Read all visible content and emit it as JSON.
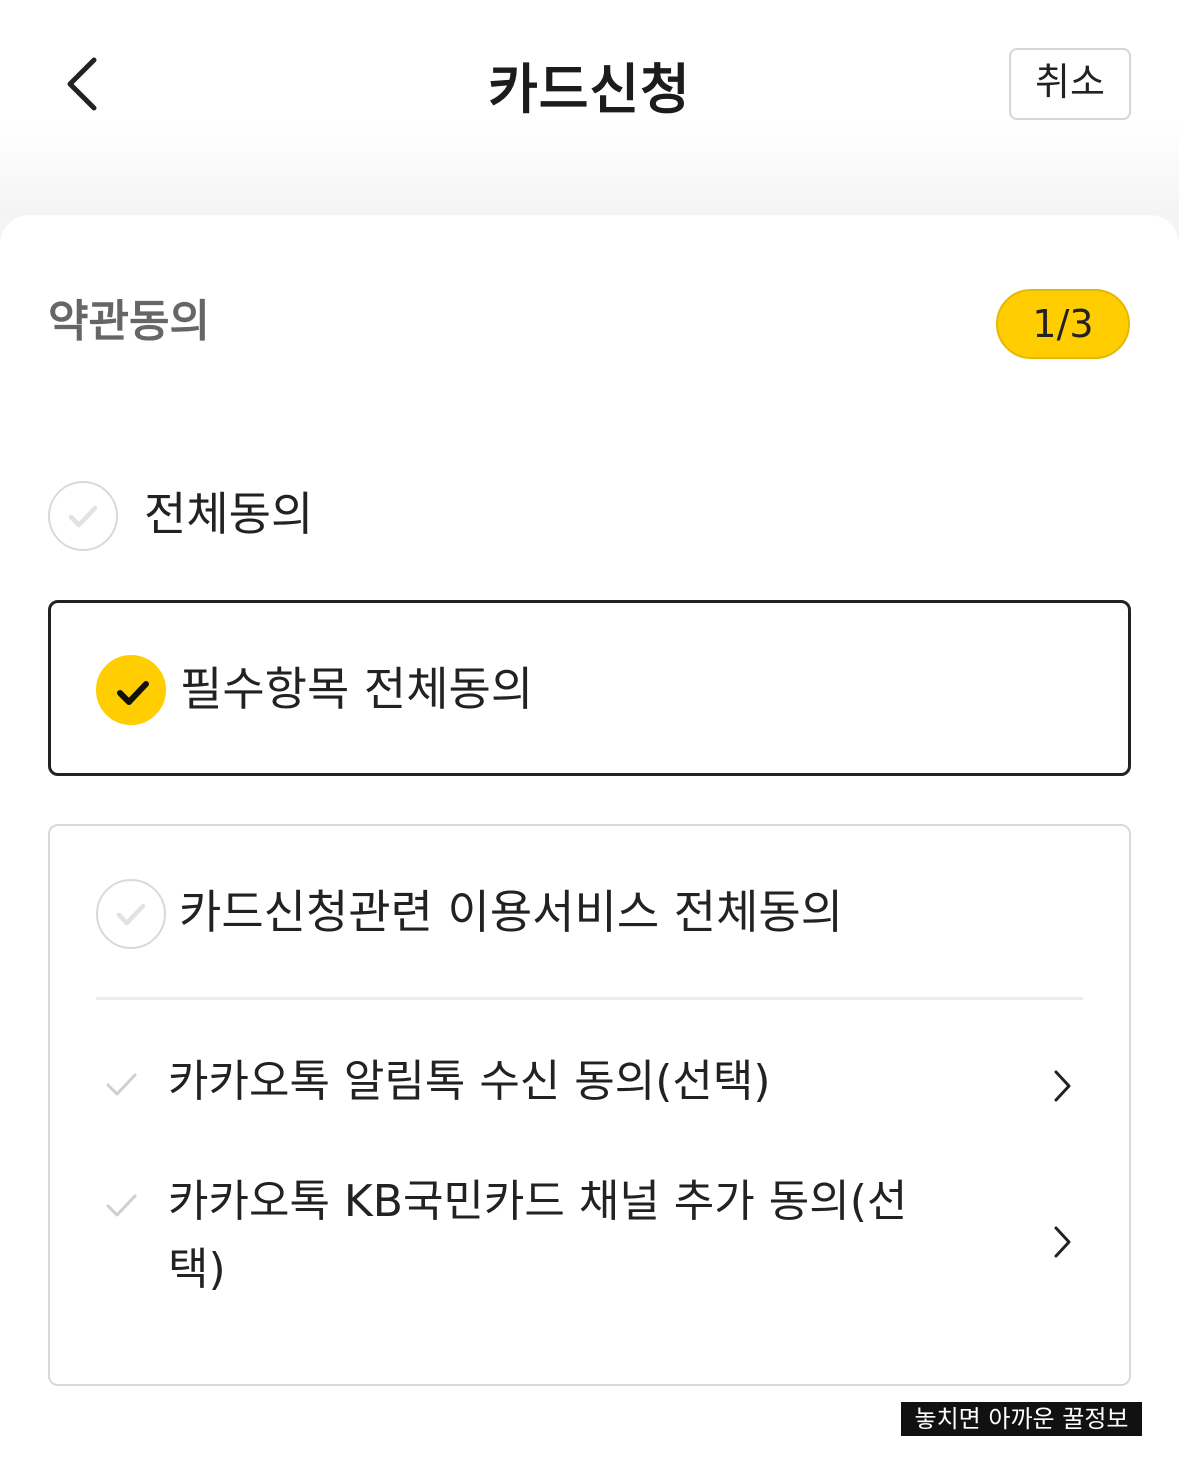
{
  "header": {
    "title": "카드신청",
    "cancel_label": "취소"
  },
  "section": {
    "title": "약관동의",
    "step": "1/3"
  },
  "agree_all": {
    "label": "전체동의",
    "checked": false
  },
  "required_all": {
    "label": "필수항목 전체동의",
    "checked": true
  },
  "optional_group": {
    "label": "카드신청관련 이용서비스 전체동의",
    "checked": false,
    "items": [
      {
        "label": "카카오톡 알림톡 수신 동의(선택)",
        "checked": false
      },
      {
        "label": "카카오톡 KB국민카드 채널 추가 동의(선택)",
        "checked": false
      }
    ]
  },
  "watermark": "놓치면 아까운 꿀정보",
  "colors": {
    "accent": "#ffcd00",
    "text": "#222222",
    "muted": "#666666",
    "border": "#d9d9d9"
  },
  "icons": {
    "back": "chevron-left-icon",
    "check": "check-icon",
    "arrow": "chevron-right-icon"
  }
}
